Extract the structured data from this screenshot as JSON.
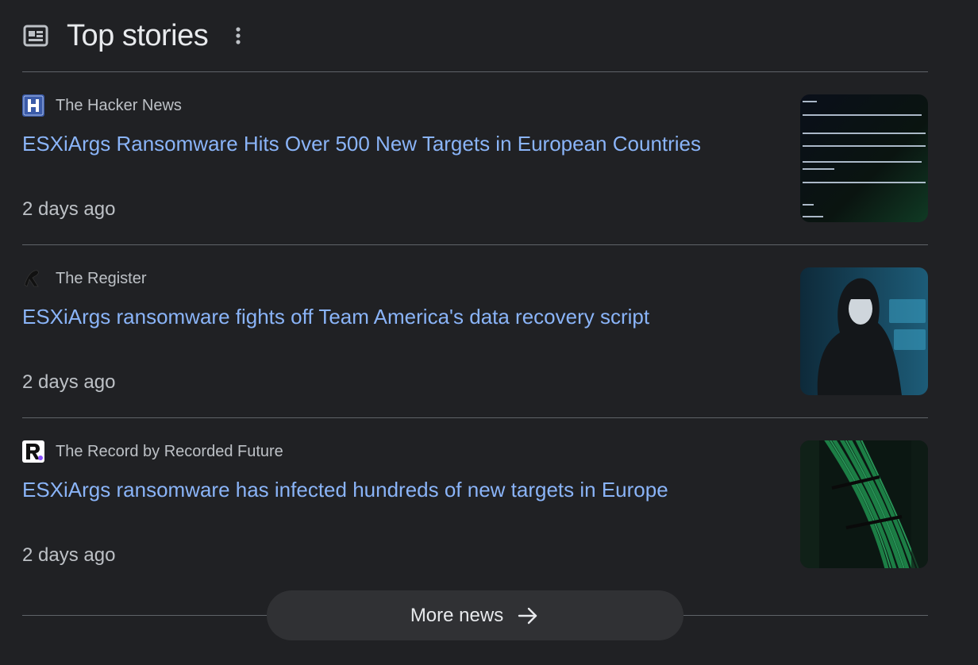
{
  "header": {
    "title": "Top stories",
    "icon": "newspaper-icon",
    "menu_icon": "more-vert-icon"
  },
  "stories": [
    {
      "source": "The Hacker News",
      "favicon": "hacker-news-logo",
      "headline": "ESXiArgs Ransomware Hits Over 500 New Targets in European Countries",
      "time": "2 days ago",
      "thumbnail": "terminal-ransom-note-image"
    },
    {
      "source": "The Register",
      "favicon": "register-logo",
      "headline": "ESXiArgs ransomware fights off Team America's data recovery script",
      "time": "2 days ago",
      "thumbnail": "hooded-hacker-image"
    },
    {
      "source": "The Record by Recorded Future",
      "favicon": "record-logo",
      "headline": "ESXiArgs ransomware has infected hundreds of new targets in Europe",
      "time": "2 days ago",
      "thumbnail": "green-cables-image"
    }
  ],
  "more_news": {
    "label": "More news",
    "icon": "arrow-right-icon"
  },
  "colors": {
    "background": "#202124",
    "link": "#8ab4f8",
    "text_secondary": "#bdc1c6",
    "divider": "#5f6368",
    "button_bg": "#303134"
  }
}
